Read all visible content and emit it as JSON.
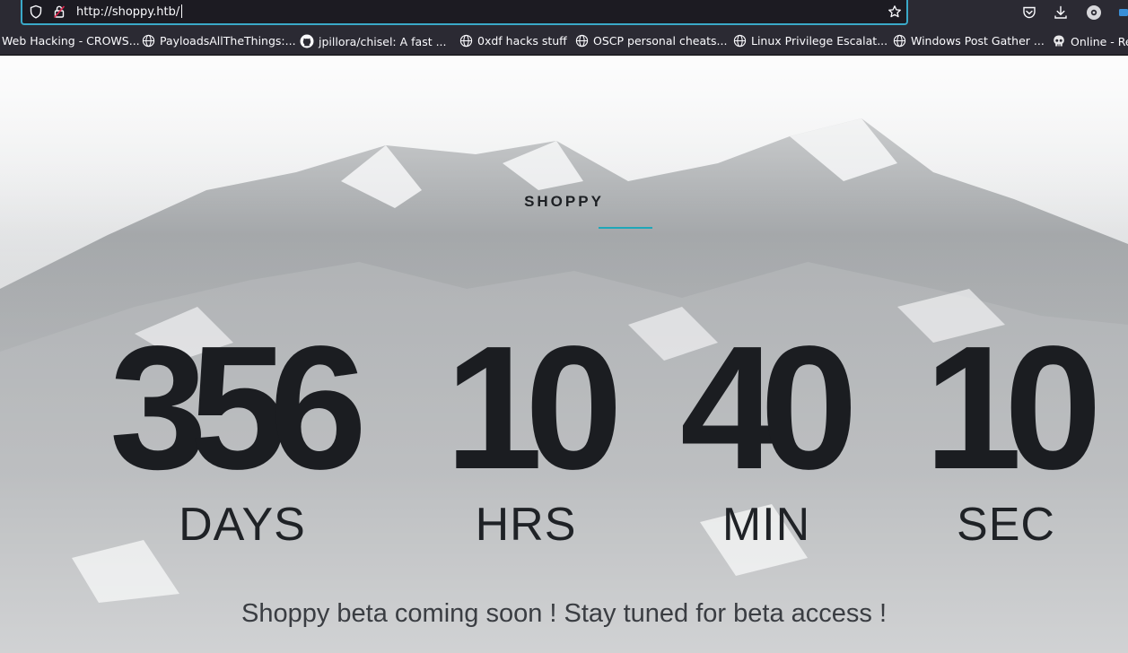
{
  "browser": {
    "url": "http://shoppy.htb/",
    "bookmarks": [
      {
        "label": "Web Hacking - CROWS...",
        "icon": "crowsnest-icon"
      },
      {
        "label": "PayloadsAllTheThings:...",
        "icon": "globe-icon"
      },
      {
        "label": "jpillora/chisel: A fast ...",
        "icon": "github-icon"
      },
      {
        "label": "0xdf hacks stuff",
        "icon": "globe-icon"
      },
      {
        "label": "OSCP personal cheats...",
        "icon": "globe-icon"
      },
      {
        "label": "Linux Privilege Escalat...",
        "icon": "globe-icon"
      },
      {
        "label": "Windows Post Gather ...",
        "icon": "globe-icon"
      },
      {
        "label": "Online - Re",
        "icon": "skull-icon"
      }
    ]
  },
  "page": {
    "brand": "SHOPPY",
    "countdown": {
      "days": {
        "value": "356",
        "label": "DAYS"
      },
      "hours": {
        "value": "10",
        "label": "HRS"
      },
      "minutes": {
        "value": "40",
        "label": "MIN"
      },
      "seconds": {
        "value": "10",
        "label": "SEC"
      }
    },
    "tagline": "Shoppy beta coming soon ! Stay tuned for beta access !"
  },
  "colors": {
    "accent": "#1fa7b8",
    "url_focus": "#3aa9c8",
    "chrome_bg": "#2b2a33",
    "text_dark": "#1b1d21"
  }
}
